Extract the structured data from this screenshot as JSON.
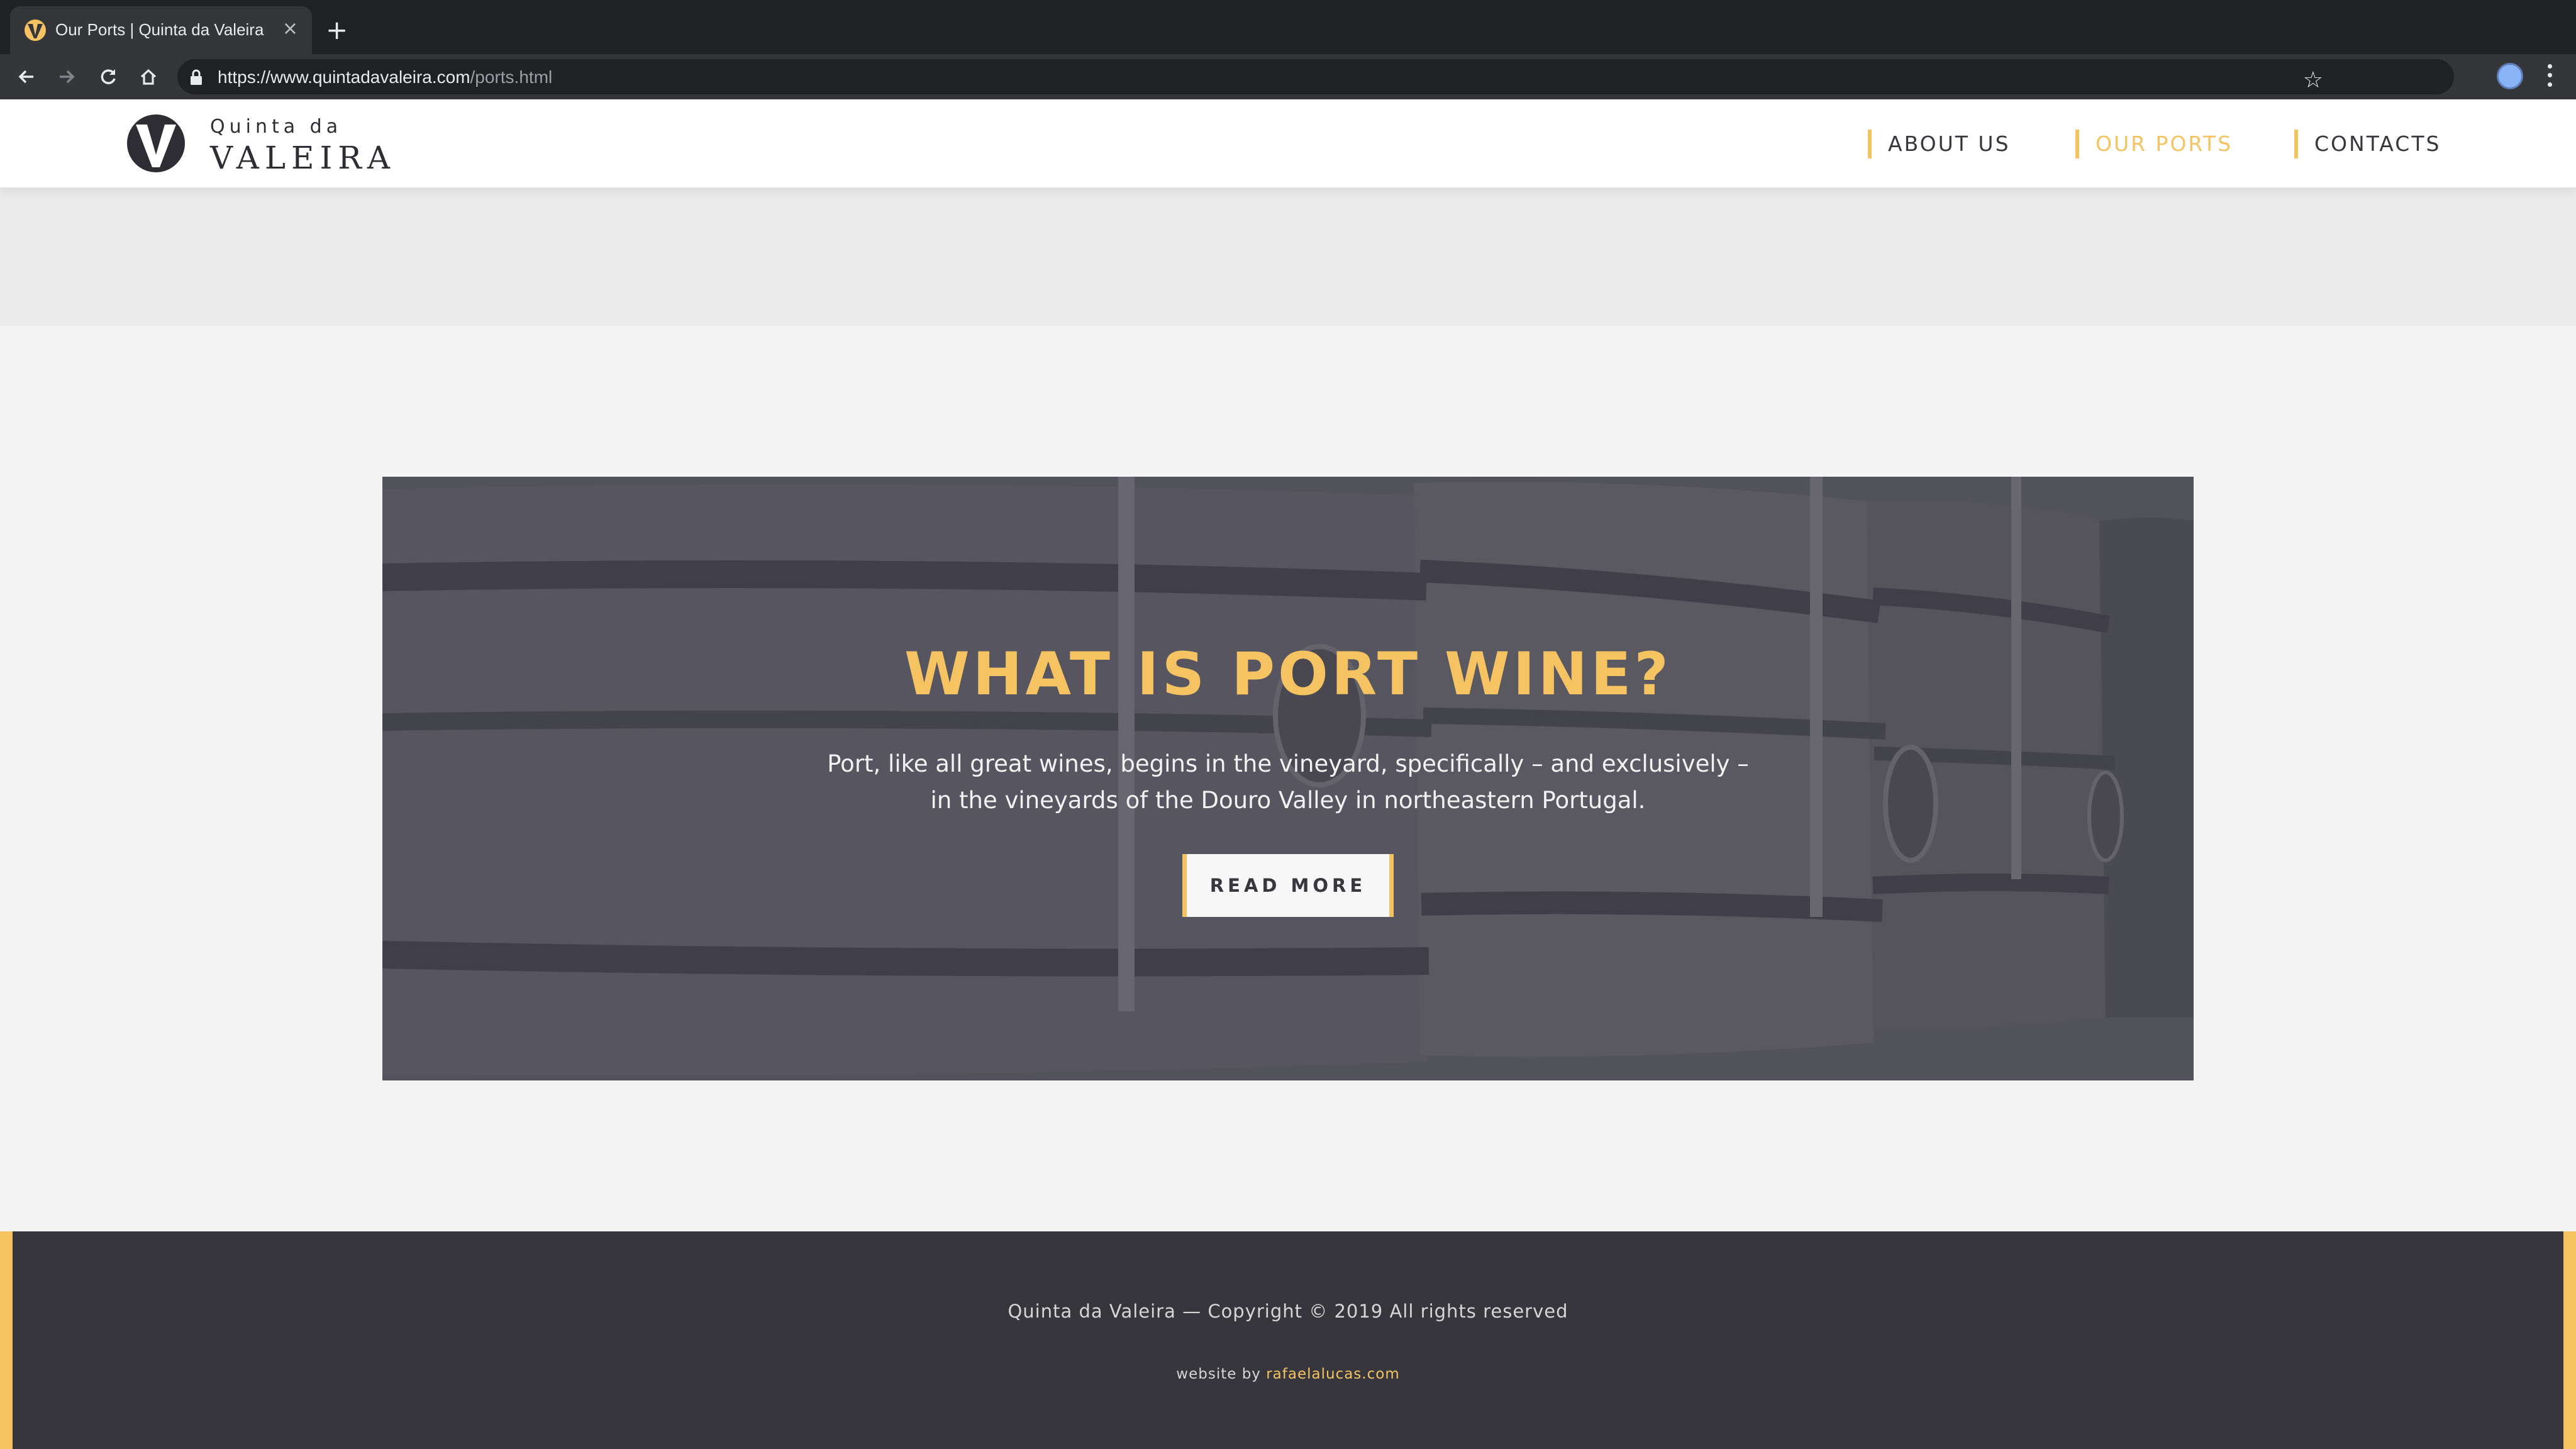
{
  "browser": {
    "tab": {
      "title": "Our Ports | Quinta da Valeira",
      "close_glyph": "×"
    },
    "new_tab_glyph": "+",
    "url": {
      "host": "https://www.quintadavaleira.com",
      "path": "/ports.html"
    },
    "icons": [
      "back-icon",
      "forward-icon",
      "reload-icon",
      "home-icon",
      "lock-icon",
      "star-icon",
      "profile-icon",
      "menu-icon"
    ]
  },
  "site": {
    "logo": {
      "small": "Quinta da",
      "big": "VALEIRA"
    },
    "nav": [
      {
        "label": "ABOUT US",
        "active": false
      },
      {
        "label": "OUR PORTS",
        "active": true
      },
      {
        "label": "CONTACTS",
        "active": false
      }
    ]
  },
  "hero": {
    "title": "WHAT IS PORT WINE?",
    "text": "Port, like all great wines, begins in the vineyard, specifically – and exclusively – in the vineyards of the Douro Valley in northeastern Portugal.",
    "button": "READ MORE"
  },
  "footer": {
    "copyright": "Quinta da Valeira — Copyright © 2019 All rights reserved",
    "credit_prefix": "website by ",
    "credit_link": "rafaelalucas.com"
  },
  "colors": {
    "accent": "#f5c362",
    "dark": "#36363c",
    "text": "#37373d"
  }
}
